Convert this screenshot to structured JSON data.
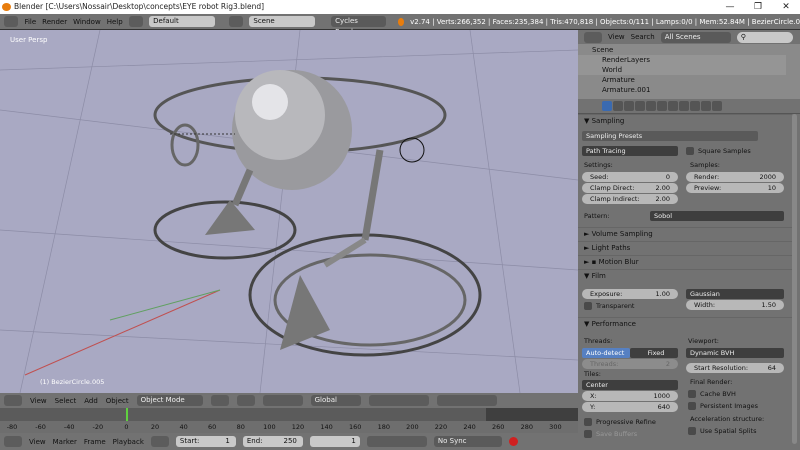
{
  "window": {
    "title": "Blender [C:\\Users\\Nossair\\Desktop\\concepts\\EYE robot Rig3.blend]",
    "minimize": "—",
    "restore": "❐",
    "close": "✕"
  },
  "topbar": {
    "menus": [
      "File",
      "Render",
      "Window",
      "Help"
    ],
    "screen_layout": "Default",
    "scene": "Scene",
    "engine": "Cycles Render",
    "stats": "v2.74 | Verts:266,352 | Faces:235,384 | Tris:470,818 | Objects:0/111 | Lamps:0/0 | Mem:52.84M | BezierCircle.0"
  },
  "viewport": {
    "view_label": "User Persp",
    "active_object": "(1) BezierCircle.005"
  },
  "header3d": {
    "menus": [
      "View",
      "Select",
      "Add",
      "Object"
    ],
    "mode": "Object Mode",
    "orientation": "Global"
  },
  "timeline": {
    "ruler": [
      "-80",
      "-60",
      "-40",
      "-20",
      "0",
      "20",
      "40",
      "60",
      "80",
      "100",
      "120",
      "140",
      "160",
      "180",
      "200",
      "220",
      "240",
      "260",
      "280",
      "300"
    ],
    "menus": [
      "View",
      "Marker",
      "Frame",
      "Playback"
    ],
    "start_label": "Start:",
    "start": "1",
    "end_label": "End:",
    "end": "250",
    "current": "1",
    "sync": "No Sync",
    "current_frame_progress": 0
  },
  "outliner": {
    "menus": [
      "View",
      "Search"
    ],
    "filter": "All Scenes",
    "items": [
      "Scene",
      "RenderLayers",
      "World",
      "Armature",
      "Armature.001"
    ]
  },
  "properties": {
    "sampling": {
      "title": "Sampling",
      "presets": "Sampling Presets",
      "integrator": "Path Tracing",
      "square_samples": "Square Samples",
      "settings_label": "Settings:",
      "seed_label": "Seed:",
      "seed": "0",
      "clamp_direct_label": "Clamp Direct:",
      "clamp_direct": "2.00",
      "clamp_indirect_label": "Clamp Indirect:",
      "clamp_indirect": "2.00",
      "samples_label": "Samples:",
      "render_label": "Render:",
      "render": "2000",
      "preview_label": "Preview:",
      "preview": "10",
      "pattern_label": "Pattern:",
      "pattern": "Sobol"
    },
    "collapsed": [
      "Volume Sampling",
      "Light Paths",
      "Motion Blur"
    ],
    "film": {
      "title": "Film",
      "exposure_label": "Exposure:",
      "exposure": "1.00",
      "transparent": "Transparent",
      "filter": "Gaussian",
      "width_label": "Width:",
      "width": "1.50"
    },
    "performance": {
      "title": "Performance",
      "threads_label": "Threads:",
      "auto": "Auto-detect",
      "fixed": "Fixed",
      "threads_field": "Threads:",
      "threads": "2",
      "tiles_label": "Tiles:",
      "tile_order": "Center",
      "x_label": "X:",
      "x": "1000",
      "y_label": "Y:",
      "y": "640",
      "progressive": "Progressive Refine",
      "save_buffers": "Save Buffers",
      "viewport_label": "Viewport:",
      "bvh": "Dynamic BVH",
      "start_res_label": "Start Resolution:",
      "start_res": "64",
      "final_label": "Final Render:",
      "cache_bvh": "Cache BVH",
      "persistent": "Persistent Images",
      "accel_label": "Acceleration structure:",
      "spatial": "Use Spatial Splits"
    }
  }
}
